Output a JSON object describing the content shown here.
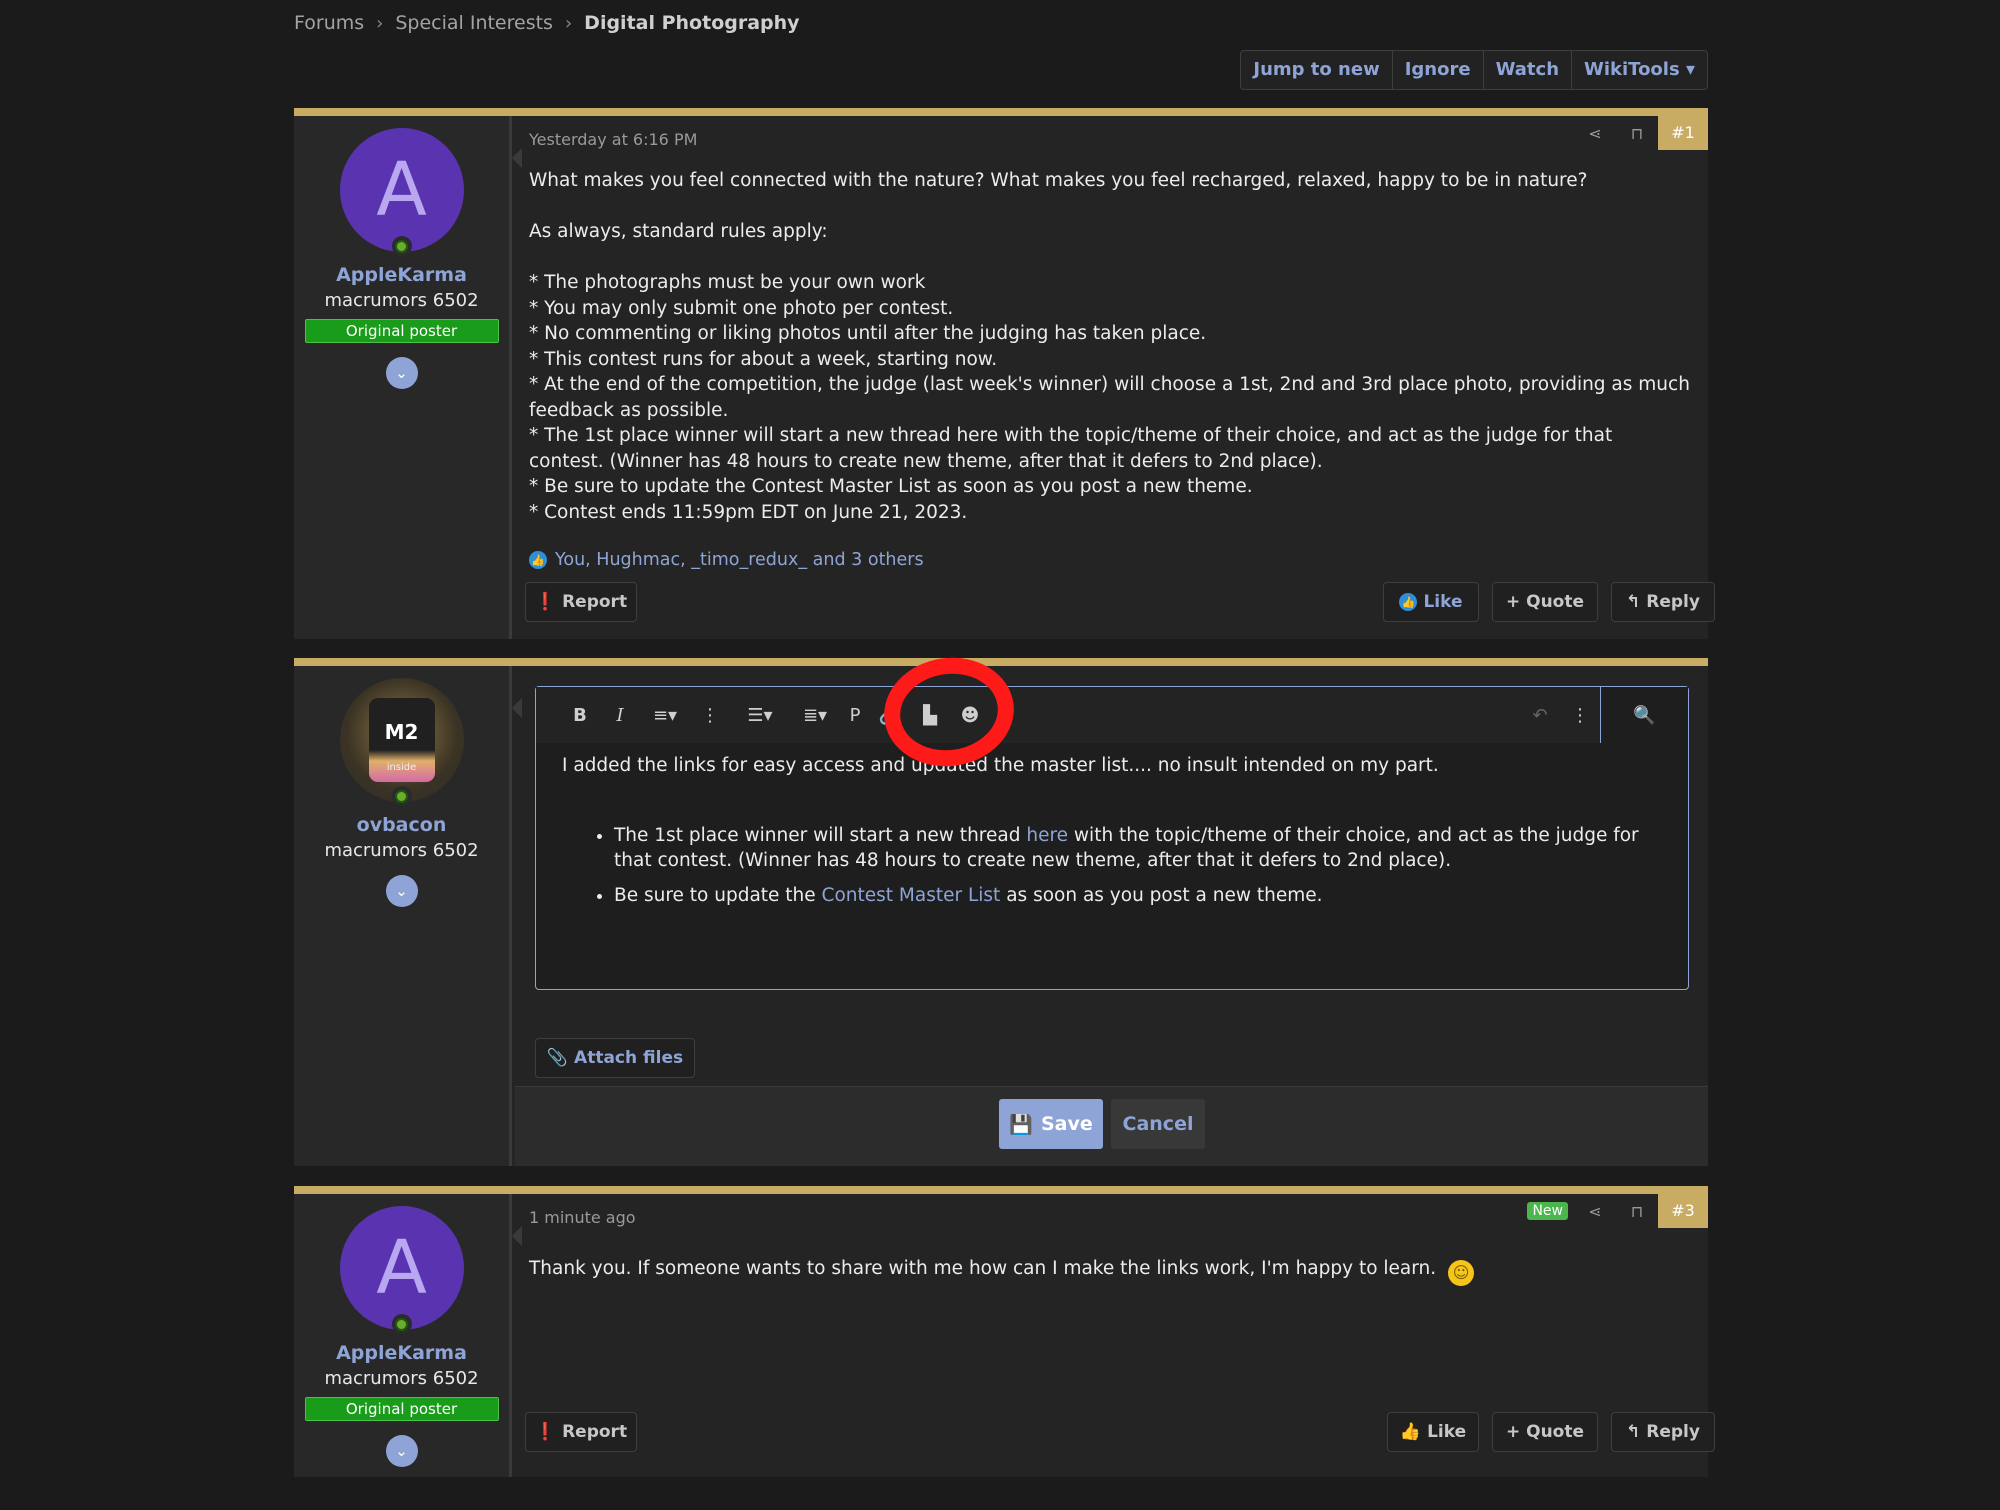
{
  "breadcrumb": {
    "forums": "Forums",
    "special": "Special Interests",
    "current": "Digital Photography",
    "sep": "›"
  },
  "thread_tools": {
    "jump": "Jump to new",
    "ignore": "Ignore",
    "watch": "Watch",
    "wikitools": "WikiTools ▾"
  },
  "post1": {
    "avatar_letter": "A",
    "username": "AppleKarma",
    "user_title": "macrumors 6502",
    "badge": "Original poster",
    "date": "Yesterday at 6:16 PM",
    "number": "#1",
    "lines": [
      "What makes you feel connected with the nature? What makes you feel recharged, relaxed, happy to be in nature?",
      "",
      "As always, standard rules apply:",
      "",
      "* The photographs must be your own work",
      "* You may only submit one photo per contest.",
      "* No commenting or liking photos until after the judging has taken place.",
      "* This contest runs for about a week, starting now.",
      "* At the end of the competition, the judge (last week's winner) will choose a 1st, 2nd and 3rd place photo, providing as much feedback as possible.",
      "* The 1st place winner will start a new thread here with the topic/theme of their choice, and act as the judge for that contest. (Winner has 48 hours to create new theme, after that it defers to 2nd place).",
      "* Be sure to update the Contest Master List as soon as you post a new theme.",
      "* Contest ends 11:59pm EDT on June 21, 2023."
    ],
    "reactions": "You, Hughmac, _timo_redux_ and 3 others",
    "report": "Report",
    "like": "Like",
    "quote": "+ Quote",
    "reply": "Reply"
  },
  "post2": {
    "avatar_chip": "M2",
    "avatar_chip_sub": "inside",
    "username": "ovbacon",
    "user_title": "macrumors 6502",
    "editor": {
      "intro": "I added the links for easy access and updated the master list.... no insult intended on my part.",
      "bullet1_pre": "The 1st place winner will start a new thread ",
      "bullet1_link": "here",
      "bullet1_post": " with the topic/theme of their choice, and act as the judge for that contest. (Winner has 48 hours to create new theme, after that it defers to 2nd place).",
      "bullet2_pre": "Be sure to update the ",
      "bullet2_link": "Contest Master List",
      "bullet2_post": " as soon as you post a new theme."
    },
    "toolbar": {
      "bold": "B",
      "italic": "I",
      "p": "P"
    },
    "attach": "Attach files",
    "save": "Save",
    "cancel": "Cancel"
  },
  "post3": {
    "avatar_letter": "A",
    "username": "AppleKarma",
    "user_title": "macrumors 6502",
    "badge": "Original poster",
    "date": "1 minute ago",
    "new_badge": "New",
    "number": "#3",
    "text": "Thank you. If someone wants to share with me how can I make the links work, I'm happy to learn.",
    "report": "Report",
    "like": "Like",
    "quote": "+ Quote",
    "reply": "Reply"
  },
  "colors": {
    "accent": "#c8ac63",
    "link": "#8fa4d6",
    "op_badge": "#199c19",
    "annotation": "#ff1a1a"
  }
}
